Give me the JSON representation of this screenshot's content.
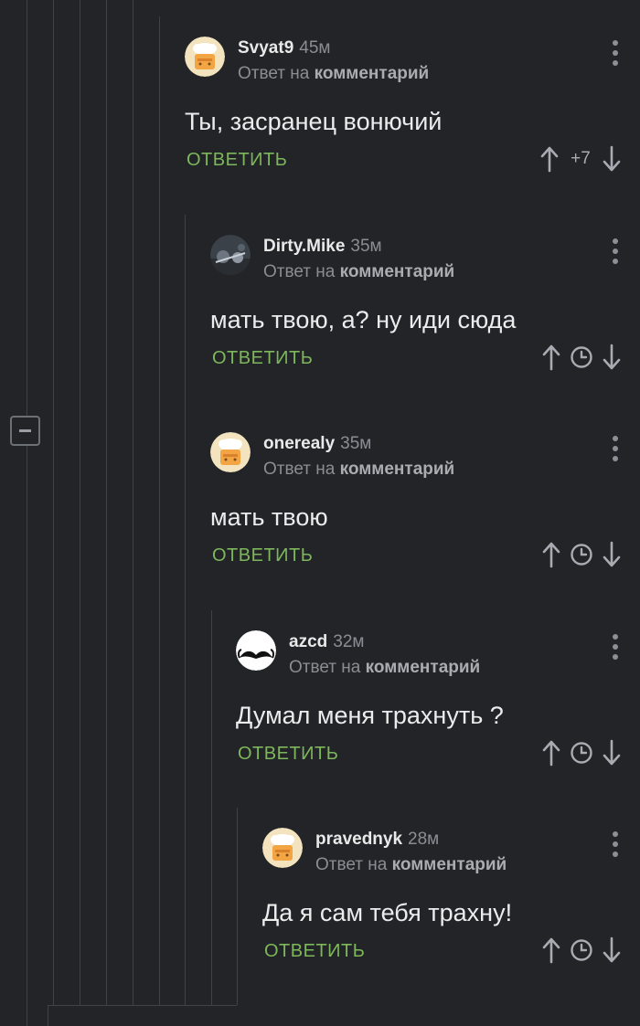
{
  "comments": [
    {
      "author": "Svyat9",
      "time": "45м",
      "reply_prefix": "Ответ на",
      "reply_link": "комментарий",
      "text": "Ты, засранец вонючий",
      "reply_label": "ОТВЕТИТЬ",
      "rating": "+7",
      "avatar": "cook-avatar"
    },
    {
      "author": "Dirty.Mike",
      "time": "35м",
      "reply_prefix": "Ответ на",
      "reply_link": "комментарий",
      "text": "мать твою, а? ну иди сюда",
      "reply_label": "ОТВЕТИТЬ",
      "rating": "",
      "avatar": "photo-avatar"
    },
    {
      "author": "onerealy",
      "time": "35м",
      "reply_prefix": "Ответ на",
      "reply_link": "комментарий",
      "text": "мать твою",
      "reply_label": "ОТВЕТИТЬ",
      "rating": "",
      "avatar": "cook-avatar"
    },
    {
      "author": "azcd",
      "time": "32м",
      "reply_prefix": "Ответ на",
      "reply_link": "комментарий",
      "text": "Думал меня трахнуть ?",
      "reply_label": "ОТВЕТИТЬ",
      "rating": "",
      "avatar": "mustache-avatar"
    },
    {
      "author": "pravednyk",
      "time": "28м",
      "reply_prefix": "Ответ на",
      "reply_link": "комментарий",
      "text": "Да я сам тебя трахну!",
      "reply_label": "ОТВЕТИТЬ",
      "rating": "",
      "avatar": "cook-avatar"
    }
  ],
  "icons": {
    "upvote": "arrow-up-icon",
    "downvote": "arrow-down-icon",
    "timer": "clock-icon",
    "menu": "more-vertical-icon",
    "collapse": "minus-box-icon"
  },
  "colors": {
    "background": "#222427",
    "accent_green": "#7db75b",
    "muted_text": "#8a8e94",
    "thread_line": "#3e4146"
  }
}
